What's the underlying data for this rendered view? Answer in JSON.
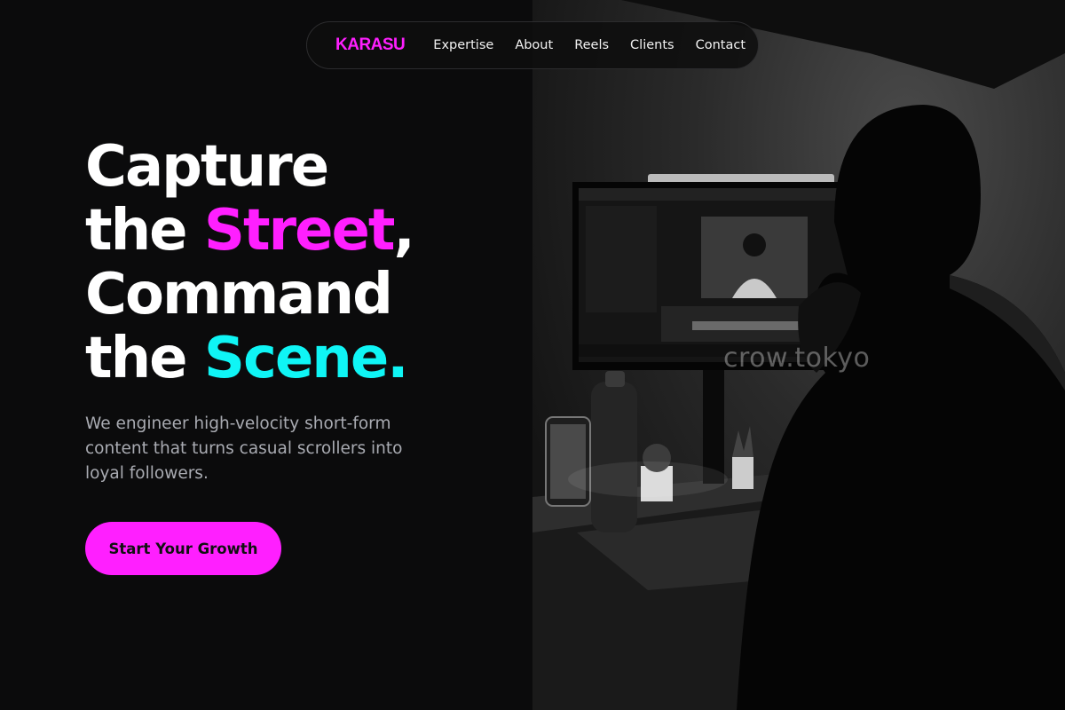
{
  "brand": {
    "name": "KARASU",
    "color": "#ff1fff"
  },
  "nav": {
    "links": [
      "Expertise",
      "About",
      "Reels",
      "Clients",
      "Contact"
    ]
  },
  "hero": {
    "headline": {
      "line1": "Capture",
      "line2_pre": "the ",
      "line2_accent": "Street",
      "line2_post": ",",
      "line3": "Command",
      "line4_pre": "the ",
      "line4_accent": "Scene",
      "line4_post": "."
    },
    "subtext": "We engineer high-velocity short-form content that turns casual scrollers into loyal followers.",
    "cta_label": "Start Your Growth",
    "colors": {
      "magenta": "#ff1fff",
      "cyan": "#0ff5f5",
      "button": "#ff1fff"
    }
  },
  "photo": {
    "watermark": "crow.tokyo",
    "icon": "editing-desk-photo"
  }
}
